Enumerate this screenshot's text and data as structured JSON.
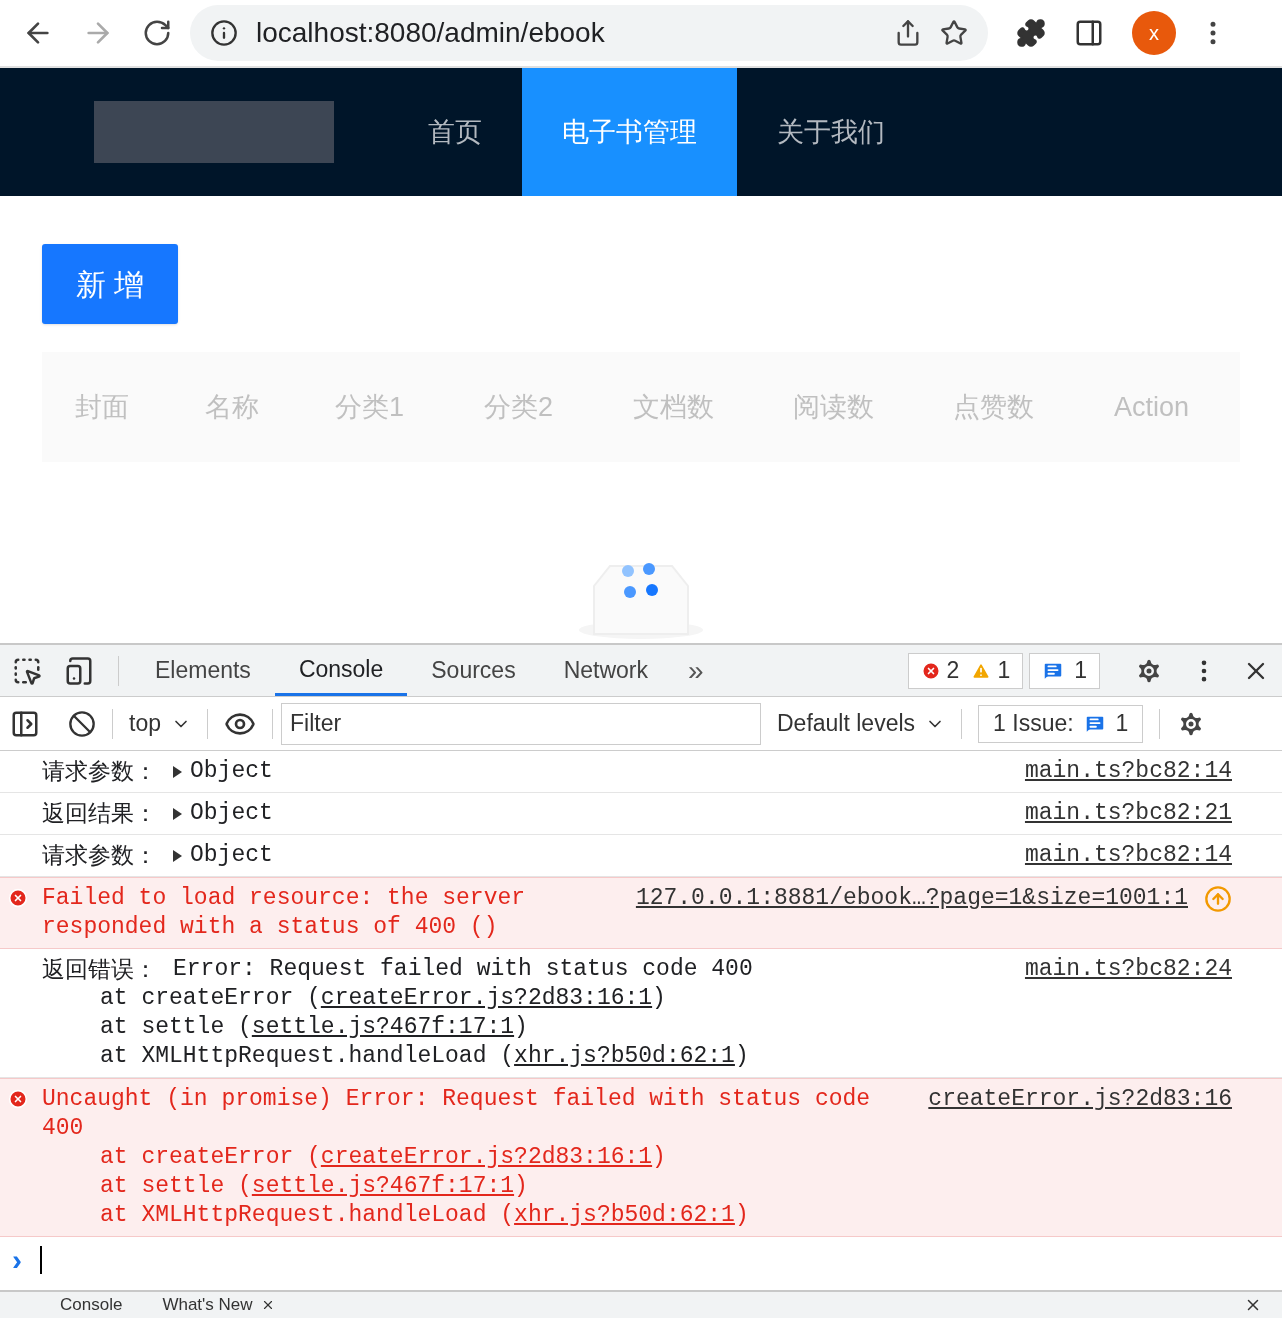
{
  "browser": {
    "url": "localhost:8080/admin/ebook",
    "profile": "x"
  },
  "header": {
    "nav": [
      {
        "label": "首页",
        "selected": false
      },
      {
        "label": "电子书管理",
        "selected": true
      },
      {
        "label": "关于我们",
        "selected": false
      }
    ]
  },
  "content": {
    "add_button": "新 增",
    "table": {
      "columns": [
        "封面",
        "名称",
        "分类1",
        "分类2",
        "文档数",
        "阅读数",
        "点赞数",
        "Action"
      ]
    }
  },
  "devtools": {
    "tabs": [
      {
        "label": "Elements",
        "selected": false
      },
      {
        "label": "Console",
        "selected": true
      },
      {
        "label": "Sources",
        "selected": false
      },
      {
        "label": "Network",
        "selected": false
      }
    ],
    "more": "»",
    "error_count": "2",
    "warning_count": "1",
    "message_count": "1",
    "context": "top",
    "filter": {
      "placeholder": "Filter"
    },
    "levels": "Default levels",
    "issues_label": "1 Issue:",
    "issues_count": "1",
    "messages": [
      {
        "kind": "log",
        "label": "请求参数：",
        "text": "Object",
        "source": "main.ts?bc82:14"
      },
      {
        "kind": "log",
        "label": "返回结果：",
        "text": "Object",
        "source": "main.ts?bc82:21"
      },
      {
        "kind": "log",
        "label": "请求参数：",
        "text": "Object",
        "source": "main.ts?bc82:14"
      },
      {
        "kind": "error",
        "text": "Failed to load resource: the server responded with a status of 400 ()",
        "source": "127.0.0.1:8881/ebook…?page=1&size=1001:1",
        "network": true
      },
      {
        "kind": "log",
        "label": "返回错误：",
        "text": "Error: Request failed with status code 400",
        "source": "main.ts?bc82:24",
        "stack": [
          {
            "prefix": "at createError (",
            "link": "createError.js?2d83:16:1",
            "suffix": ")"
          },
          {
            "prefix": "at settle (",
            "link": "settle.js?467f:17:1",
            "suffix": ")"
          },
          {
            "prefix": "at XMLHttpRequest.handleLoad (",
            "link": "xhr.js?b50d:62:1",
            "suffix": ")"
          }
        ]
      },
      {
        "kind": "error",
        "text": "Uncaught (in promise) Error: Request failed with status code 400",
        "source": "createError.js?2d83:16",
        "stack": [
          {
            "prefix": "at createError (",
            "link": "createError.js?2d83:16:1",
            "suffix": ")"
          },
          {
            "prefix": "at settle (",
            "link": "settle.js?467f:17:1",
            "suffix": ")"
          },
          {
            "prefix": "at XMLHttpRequest.handleLoad (",
            "link": "xhr.js?b50d:62:1",
            "suffix": ")"
          }
        ]
      }
    ],
    "prompt": "›",
    "drawer_tabs": [
      "Console",
      "What's New"
    ]
  }
}
